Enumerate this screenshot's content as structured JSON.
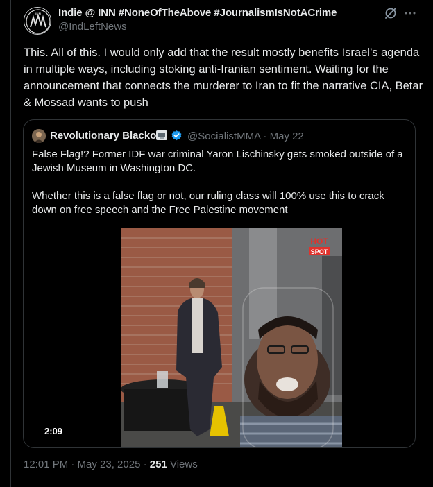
{
  "author": {
    "name": "Indie @ INN #NoneOfTheAbove #JournalismIsNotACrime",
    "handle": "@IndLeftNews",
    "avatar_text": "INN"
  },
  "tweet_text": "This. All of this. I would only add that the result mostly benefits Israel’s agenda in multiple ways, including stoking anti-Iranian sentiment. Waiting for the announcement that connects the murderer to Iran to fit the narrative CIA, Betar & Mossad wants to push",
  "quoted": {
    "name": "Revolutionary Blackout",
    "handle_date": "@SocialistMMA · May 22",
    "text1": "False Flag!? Former IDF war criminal Yaron Lischinsky gets smoked outside of a Jewish Museum in Washington DC.",
    "text2": "Whether this is a false flag or not, our ruling class will 100% use this to crack down on free speech and the Free Palestine movement",
    "video_duration": "2:09",
    "video_logo_top": "HOT",
    "video_logo_bottom": "SPOT"
  },
  "footer": {
    "time_date": "12:01 PM · May 23, 2025 · ",
    "views_count": "251",
    "views_label": " Views"
  },
  "icons": {
    "grok": "grok-icon",
    "more": "more-icon",
    "verified": "verified-icon"
  },
  "colors": {
    "background": "#000000",
    "text": "#e7e9ea",
    "muted": "#71767b",
    "border": "#2f3336",
    "verified": "#1d9bf0"
  }
}
